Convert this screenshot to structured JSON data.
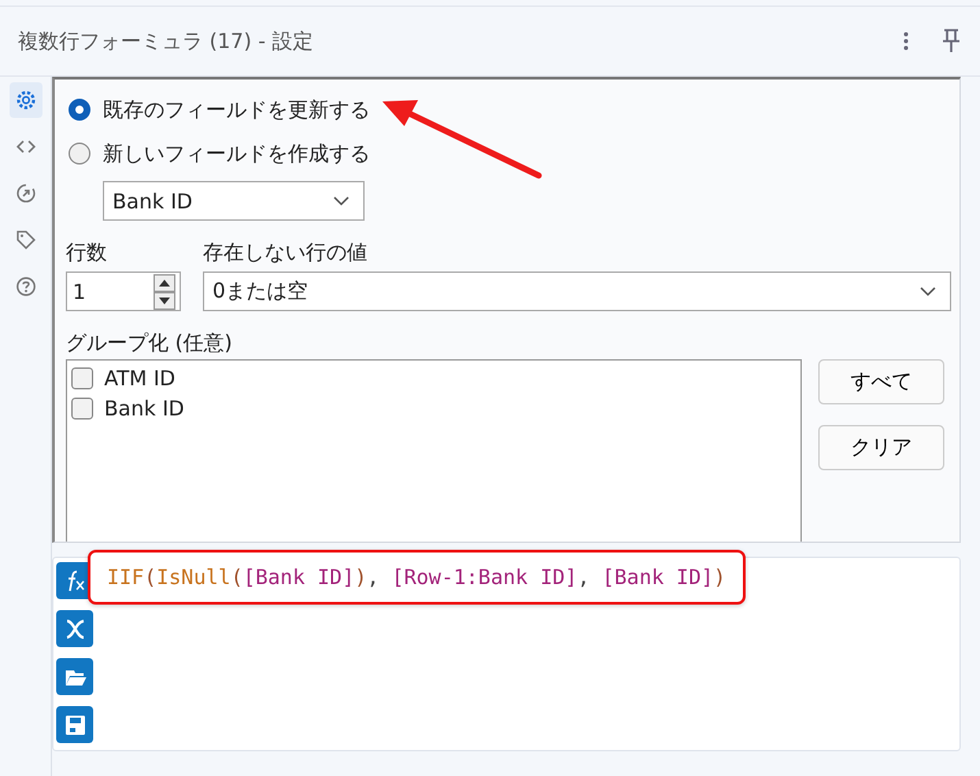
{
  "window": {
    "title": "複数行フォーミュラ (17) - 設定"
  },
  "sidebar": {
    "items": [
      {
        "kind": "gear",
        "selected": true
      },
      {
        "kind": "code",
        "selected": false
      },
      {
        "kind": "arrow",
        "selected": false
      },
      {
        "kind": "tag",
        "selected": false
      },
      {
        "kind": "help",
        "selected": false
      }
    ]
  },
  "mode_options": [
    {
      "label": "既存のフィールドを更新する",
      "selected": true
    },
    {
      "label": "新しいフィールドを作成する",
      "selected": false
    }
  ],
  "field_dropdown": {
    "value": "Bank ID"
  },
  "rows": {
    "label": "行数",
    "value": "1"
  },
  "missing_rows": {
    "label": "存在しない行の値",
    "value": "0または空"
  },
  "grouping": {
    "label": "グループ化 (任意)",
    "items": [
      {
        "label": "ATM ID",
        "checked": false
      },
      {
        "label": "Bank ID",
        "checked": false
      }
    ],
    "buttons": [
      "すべて",
      "クリア"
    ]
  },
  "editor": {
    "tools": [
      {
        "kind": "fx"
      },
      {
        "kind": "variable"
      },
      {
        "kind": "open"
      },
      {
        "kind": "save"
      }
    ],
    "highlighted": true,
    "formula": [
      {
        "text": "IIF",
        "kind": "func"
      },
      {
        "text": "(",
        "kind": "paren"
      },
      {
        "text": "IsNull",
        "kind": "func"
      },
      {
        "text": "(",
        "kind": "paren"
      },
      {
        "text": "[Bank ID]",
        "kind": "field"
      },
      {
        "text": ")",
        "kind": "paren"
      },
      {
        "text": ", ",
        "kind": "punct"
      },
      {
        "text": "[Row-1:Bank ID]",
        "kind": "field"
      },
      {
        "text": ", ",
        "kind": "punct"
      },
      {
        "text": "[Bank ID]",
        "kind": "field"
      },
      {
        "text": ")",
        "kind": "paren"
      }
    ]
  },
  "annotation_arrow": true
}
